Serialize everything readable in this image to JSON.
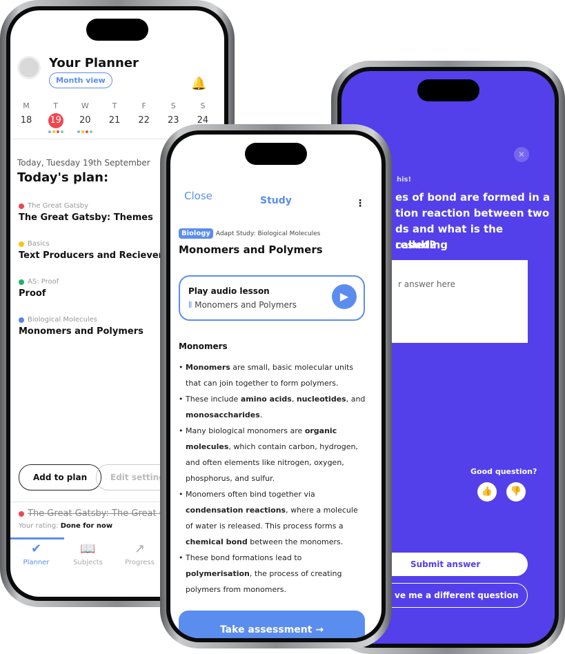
{
  "planner": {
    "title": "Your Planner",
    "month_view": "Month view",
    "days": [
      {
        "d": "M",
        "n": "18"
      },
      {
        "d": "T",
        "n": "19",
        "selected": true
      },
      {
        "d": "W",
        "n": "20"
      },
      {
        "d": "T",
        "n": "21"
      },
      {
        "d": "F",
        "n": "22"
      },
      {
        "d": "S",
        "n": "23"
      },
      {
        "d": "S",
        "n": "24"
      }
    ],
    "today_label": "Today, Tuesday 19th September",
    "plan_heading": "Today's plan:",
    "items": [
      {
        "subject": "The Great Gatsby",
        "title": "The Great Gatsby: Themes",
        "color": "#f0474e"
      },
      {
        "subject": "Basics",
        "title": "Text Producers and Recievers",
        "color": "#f6c21c"
      },
      {
        "subject": "AS: Proof",
        "title": "Proof",
        "color": "#1fb36e"
      },
      {
        "subject": "Biological Molecules",
        "title": "Monomers and Polymers",
        "color": "#5b7ff0"
      }
    ],
    "add_to_plan": "Add to plan",
    "edit_settings": "Edit settings",
    "done_item": "The Great Gatsby: The Great Gatsby",
    "rating_label": "Your rating:",
    "rating_value": "Done for now",
    "nav": [
      {
        "label": "Planner",
        "icon": "check-circle-icon"
      },
      {
        "label": "Subjects",
        "icon": "book-icon"
      },
      {
        "label": "Progress",
        "icon": "trend-icon"
      }
    ]
  },
  "study": {
    "close": "Close",
    "title": "Study",
    "tag": "Biology",
    "crumb": "Adapt Study: Biological Molecules",
    "heading": "Monomers and Polymers",
    "audio_title": "Play audio lesson",
    "audio_sub": "Monomers and Polymers",
    "section": "Monomers",
    "bullets": [
      [
        {
          "t": "Monomers",
          "b": true
        },
        {
          "t": " are small, basic molecular units that can join together to form polymers."
        }
      ],
      [
        {
          "t": "These include "
        },
        {
          "t": "amino acids",
          "b": true
        },
        {
          "t": ", "
        },
        {
          "t": "nucleotides",
          "b": true
        },
        {
          "t": ", and "
        },
        {
          "t": "monosaccharides",
          "b": true
        },
        {
          "t": "."
        }
      ],
      [
        {
          "t": "Many biological monomers are "
        },
        {
          "t": "organic molecules",
          "b": true
        },
        {
          "t": ", which contain carbon, hydrogen, and often elements like nitrogen, oxygen, phosphorus, and sulfur."
        }
      ],
      [
        {
          "t": "Monomers often bind together via "
        },
        {
          "t": "condensation reactions",
          "b": true
        },
        {
          "t": ", where a molecule of water is released. This process forms a "
        },
        {
          "t": "chemical bond",
          "b": true
        },
        {
          "t": " between the monomers."
        }
      ],
      [
        {
          "t": "These bond formations lead to "
        },
        {
          "t": "polymerisation",
          "b": true
        },
        {
          "t": ", the process of creating polymers from monomers."
        }
      ]
    ],
    "take_assessment": "Take assessment →"
  },
  "quiz": {
    "prompt": "his!",
    "question_lines": [
      "es of bond are formed in a",
      "tion reaction between two",
      "ds and what is the resulting",
      "called?"
    ],
    "answer_placeholder": "r answer here",
    "good_question": "Good question?",
    "submit": "Submit answer",
    "different": "ve me a different question",
    "accent": "#5340ea"
  }
}
